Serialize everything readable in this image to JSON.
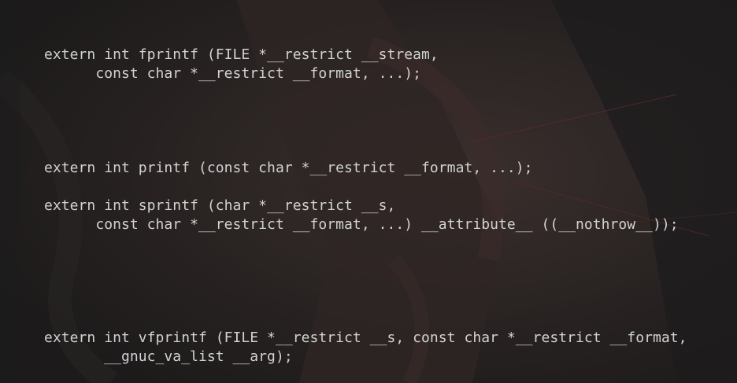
{
  "editor": {
    "lines": [
      "extern int fprintf (FILE *__restrict __stream,",
      "      const char *__restrict __format, ...);",
      "extern int printf (const char *__restrict __format, ...);",
      "extern int sprintf (char *__restrict __s,",
      "      const char *__restrict __format, ...) __attribute__ ((__nothrow__));",
      "extern int vfprintf (FILE *__restrict __s, const char *__restrict __format,",
      "       __gnuc_va_list __arg);"
    ]
  },
  "colors": {
    "text": "#d2d2d2",
    "background": "#222020"
  }
}
